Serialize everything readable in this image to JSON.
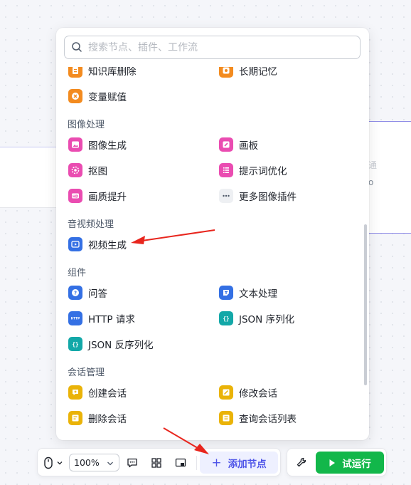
{
  "search": {
    "placeholder": "搜索节点、插件、工作流"
  },
  "sections": {
    "image": "图像处理",
    "av": "音视频处理",
    "component": "组件",
    "session": "会话管理"
  },
  "items": {
    "kb_delete": "知识库删除",
    "long_memory": "长期记忆",
    "var_assign": "变量赋值",
    "image_gen": "图像生成",
    "canvas": "画板",
    "cutout": "抠图",
    "prompt_opt": "提示词优化",
    "quality_up": "画质提升",
    "more_image_plugins": "更多图像插件",
    "video_gen": "视频生成",
    "qa": "问答",
    "text_proc": "文本处理",
    "http_request": "HTTP 请求",
    "json_serialize": "JSON 序列化",
    "json_deserialize": "JSON 反序列化",
    "create_session": "创建会话",
    "modify_session": "修改会话",
    "delete_session": "删除会话",
    "query_session_list": "查询会话列表"
  },
  "toolbar": {
    "zoom": "100%",
    "add_node": "添加节点",
    "run": "试运行"
  },
  "background": {
    "frag_char": "通",
    "frag_char2": "o"
  },
  "colors": {
    "orange": "#f38b1f",
    "pink": "#ea4cb1",
    "blue": "#3470e4",
    "teal": "#13a8a8",
    "yellow": "#eab308",
    "accent": "#4d53e8",
    "run_green": "#12b74a",
    "arrow_red": "#e8251d"
  },
  "icons": {
    "search": "search-icon",
    "mouse": "mouse-icon",
    "comment": "comment-icon",
    "layout": "layout-icon",
    "minimap": "minimap-icon",
    "wrench": "wrench-icon",
    "play": "play-icon"
  }
}
